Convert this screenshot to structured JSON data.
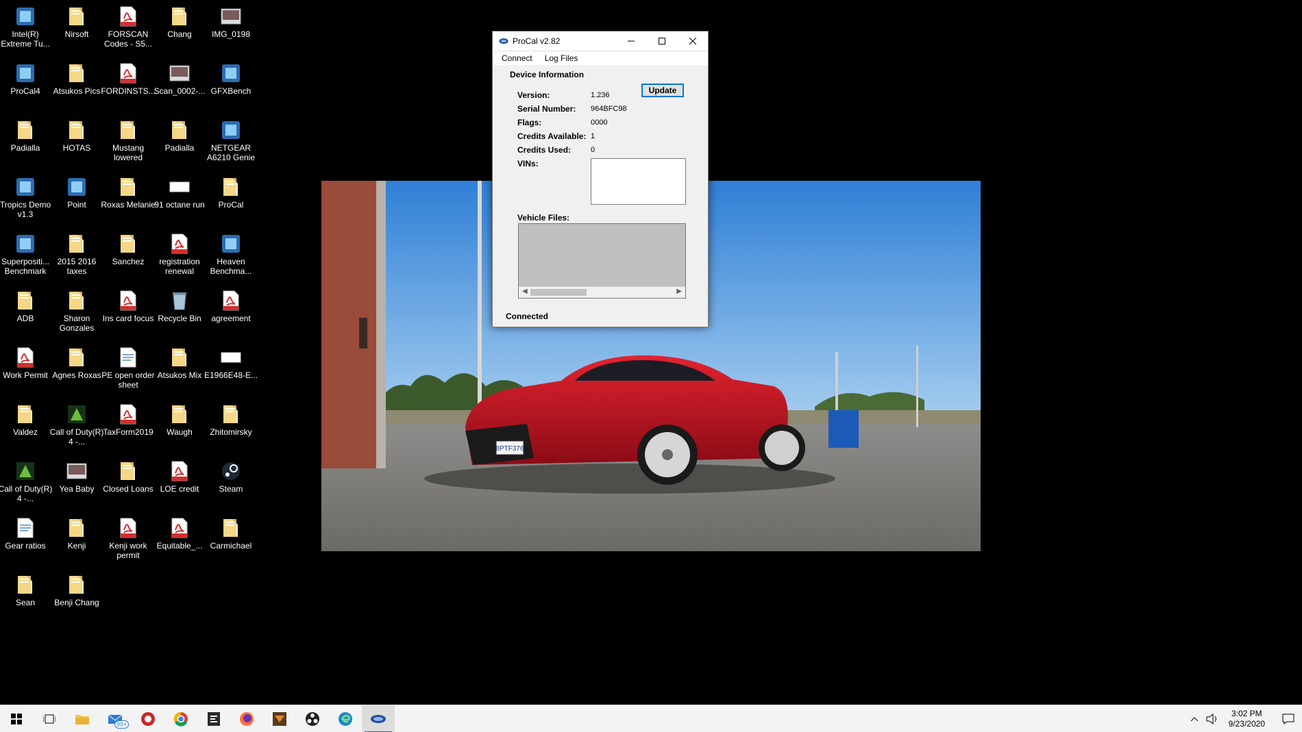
{
  "desktop": {
    "icons": [
      {
        "label": "Intel(R) Extreme Tu...",
        "type": "app"
      },
      {
        "label": "Nirsoft",
        "type": "folder"
      },
      {
        "label": "FORSCAN Codes - S5...",
        "type": "pdf"
      },
      {
        "label": "Chang",
        "type": "folder"
      },
      {
        "label": "IMG_0198",
        "type": "image"
      },
      {
        "label": "ProCal4",
        "type": "app"
      },
      {
        "label": "Atsukos Pics",
        "type": "folder"
      },
      {
        "label": "FORDINSTS...",
        "type": "pdf"
      },
      {
        "label": "Scan_0002-...",
        "type": "image"
      },
      {
        "label": "GFXBench",
        "type": "app"
      },
      {
        "label": "Padialla",
        "type": "folder"
      },
      {
        "label": "HOTAS",
        "type": "folder"
      },
      {
        "label": "Mustang lowered",
        "type": "folder"
      },
      {
        "label": "Padialla",
        "type": "folder"
      },
      {
        "label": "NETGEAR A6210 Genie",
        "type": "app"
      },
      {
        "label": "Tropics Demo v1.3",
        "type": "app"
      },
      {
        "label": "Point",
        "type": "app"
      },
      {
        "label": "Roxas Melanie",
        "type": "folder"
      },
      {
        "label": "91 octane run",
        "type": "blank"
      },
      {
        "label": "ProCal",
        "type": "folder"
      },
      {
        "label": "Superpositi... Benchmark",
        "type": "app"
      },
      {
        "label": "2015 2016 taxes",
        "type": "folder"
      },
      {
        "label": "Sanchez",
        "type": "folder"
      },
      {
        "label": "registration renewal",
        "type": "pdf"
      },
      {
        "label": "Heaven Benchma...",
        "type": "app"
      },
      {
        "label": "ADB",
        "type": "folder"
      },
      {
        "label": "Sharon Gonzales",
        "type": "folder"
      },
      {
        "label": "Ins card focus",
        "type": "pdf"
      },
      {
        "label": "Recycle Bin",
        "type": "bin"
      },
      {
        "label": "agreement",
        "type": "pdf"
      },
      {
        "label": "Work Permit",
        "type": "pdf"
      },
      {
        "label": "Agnes Roxas",
        "type": "folder"
      },
      {
        "label": "PE open order sheet",
        "type": "doc"
      },
      {
        "label": "Atsukos Mix",
        "type": "folder"
      },
      {
        "label": "E1966E48-E...",
        "type": "blank"
      },
      {
        "label": "Valdez",
        "type": "folder"
      },
      {
        "label": "Call of Duty(R) 4 -...",
        "type": "game"
      },
      {
        "label": "TaxForm2019",
        "type": "pdf"
      },
      {
        "label": "Waugh",
        "type": "folder"
      },
      {
        "label": "Zhitomirsky",
        "type": "folder"
      },
      {
        "label": "Call of Duty(R) 4 -...",
        "type": "game"
      },
      {
        "label": "Yea Baby",
        "type": "image"
      },
      {
        "label": "Closed Loans",
        "type": "folder"
      },
      {
        "label": "LOE credit",
        "type": "pdf"
      },
      {
        "label": "Steam",
        "type": "steam"
      },
      {
        "label": "Gear ratios",
        "type": "doc"
      },
      {
        "label": "Kenji",
        "type": "folder"
      },
      {
        "label": "Kenji work permit",
        "type": "pdf"
      },
      {
        "label": "Equitable_...",
        "type": "pdf"
      },
      {
        "label": "Carmichael",
        "type": "folder"
      },
      {
        "label": "Sean",
        "type": "folder"
      },
      {
        "label": "Benji Chang",
        "type": "folder"
      }
    ]
  },
  "wallpaper": {
    "plate": "8PTF376"
  },
  "window": {
    "title": "ProCal v2.82",
    "menu": [
      "Connect",
      "Log Files"
    ],
    "group_title": "Device Information",
    "update_label": "Update",
    "fields": [
      {
        "label": "Version:",
        "value": "1.236"
      },
      {
        "label": "Serial Number:",
        "value": "964BFC98"
      },
      {
        "label": "Flags:",
        "value": "0000"
      },
      {
        "label": "Credits Available:",
        "value": "1"
      },
      {
        "label": "Credits Used:",
        "value": "0"
      }
    ],
    "vins_label": "VINs:",
    "vehicle_files_label": "Vehicle Files:",
    "status": "Connected"
  },
  "taskbar": {
    "mail_badge": "99+",
    "time": "3:02 PM",
    "date": "9/23/2020"
  },
  "colors": {
    "accent": "#0078d7",
    "folder": "#f6d27a",
    "pdf": "#d32f2f",
    "car": "#c8102e"
  }
}
